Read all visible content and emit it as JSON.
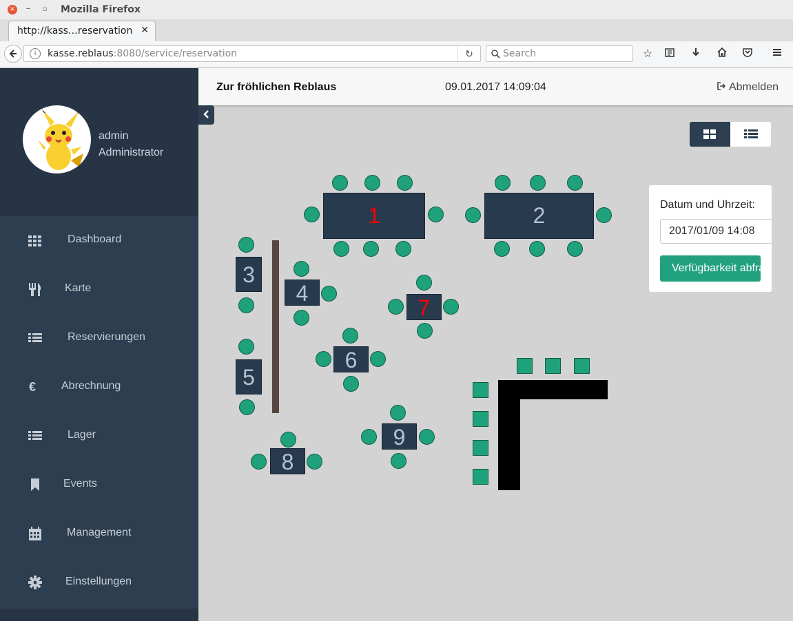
{
  "browser": {
    "window_title": "Mozilla Firefox",
    "tab_title": "http://kass…reservation",
    "url_host": "kasse.reblaus",
    "url_rest": ":8080/service/reservation",
    "search_placeholder": "Search"
  },
  "header": {
    "restaurant_name": "Zur fröhlichen Reblaus",
    "datetime": "09.01.2017 14:09:04",
    "logout_label": "Abmelden"
  },
  "user": {
    "name": "admin",
    "role": "Administrator"
  },
  "sidebar": {
    "items": [
      {
        "label": "Dashboard",
        "icon": "th-icon"
      },
      {
        "label": "Karte",
        "icon": "cutlery-icon"
      },
      {
        "label": "Reservierungen",
        "icon": "list-icon"
      },
      {
        "label": "Abrechnung",
        "icon": "euro-icon"
      },
      {
        "label": "Lager",
        "icon": "list-icon"
      },
      {
        "label": "Events",
        "icon": "bookmark-icon"
      },
      {
        "label": "Management",
        "icon": "calendar-icon"
      },
      {
        "label": "Einstellungen",
        "icon": "gear-icon"
      }
    ]
  },
  "tables": [
    {
      "number": "1",
      "color": "#ff0000"
    },
    {
      "number": "2",
      "color": "#b5c3d1"
    },
    {
      "number": "3",
      "color": "#b5c3d1"
    },
    {
      "number": "4",
      "color": "#b5c3d1"
    },
    {
      "number": "5",
      "color": "#b5c3d1"
    },
    {
      "number": "6",
      "color": "#b5c3d1"
    },
    {
      "number": "7",
      "color": "#ff0000"
    },
    {
      "number": "8",
      "color": "#b5c3d1"
    },
    {
      "number": "9",
      "color": "#b5c3d1"
    }
  ],
  "availability_panel": {
    "label": "Datum und Uhrzeit:",
    "datetime_value": "2017/01/09 14:08",
    "button_label": "Verfügbarkeit abfragen"
  },
  "colors": {
    "sidebar": "#2c3e50",
    "seat": "#1fa27c",
    "occupied_table_text": "#ff0000",
    "button": "#22a17f"
  }
}
